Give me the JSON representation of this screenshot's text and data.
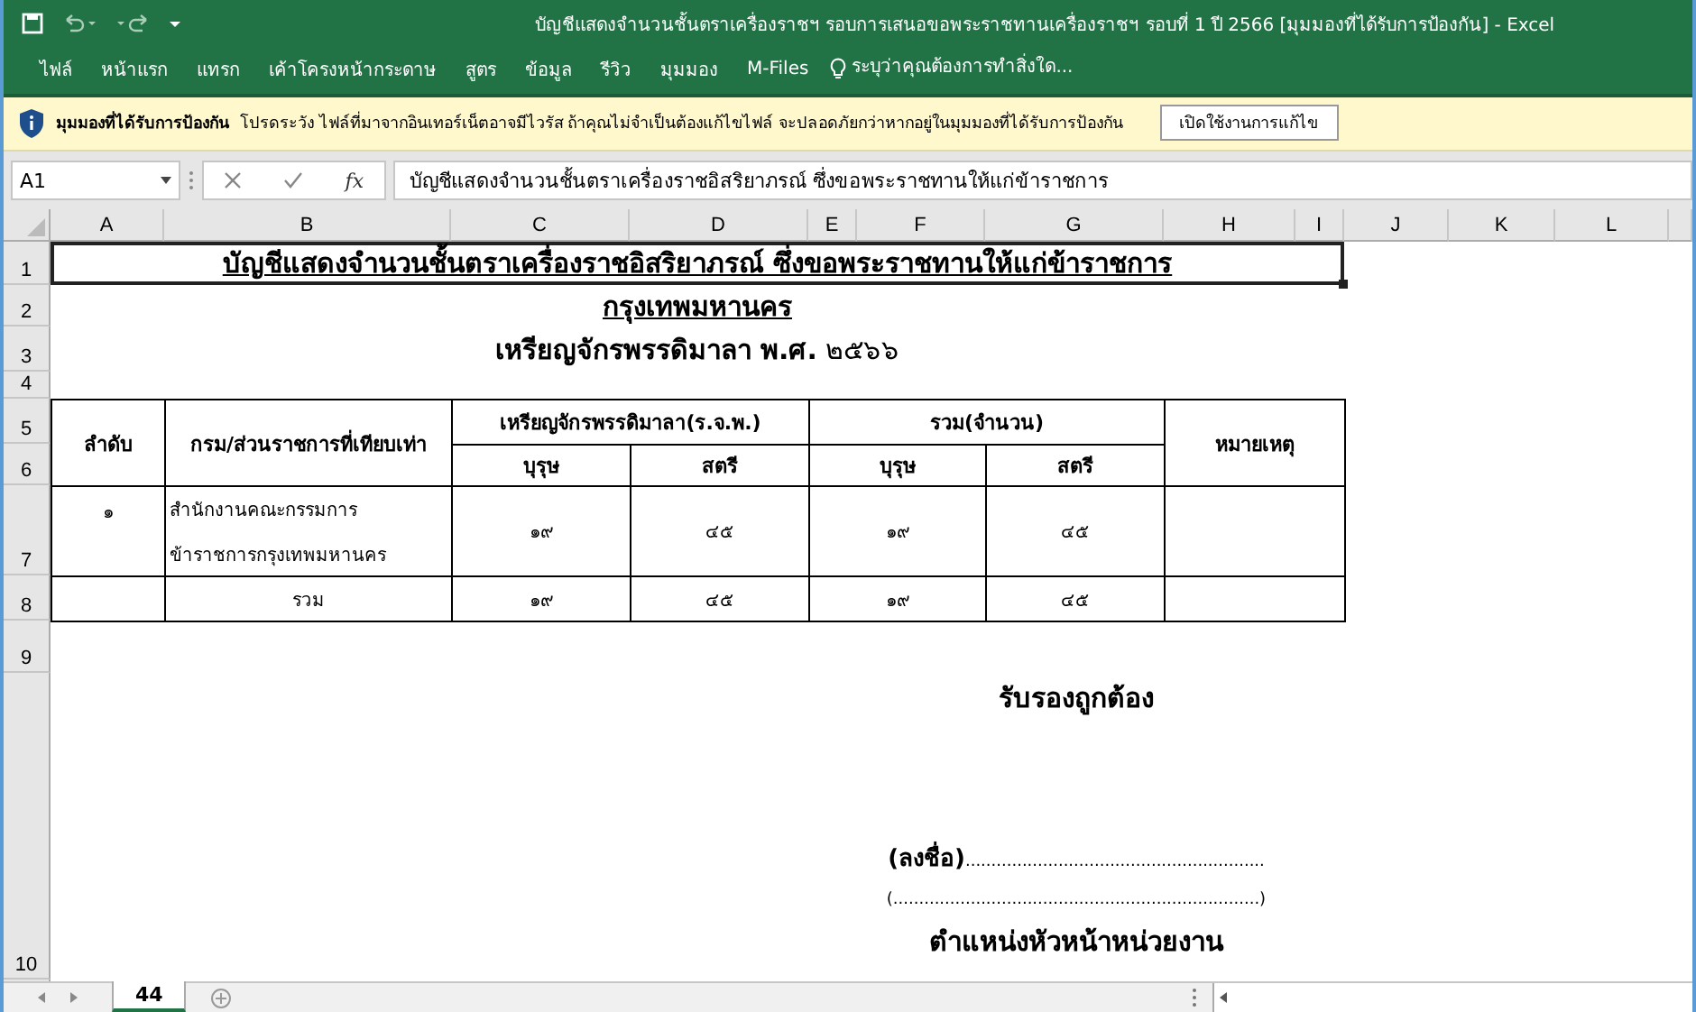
{
  "window": {
    "title": "บัญชีแสดงจำนวนชั้นตราเครื่องราชฯ รอบการเสนอขอพระราชทานเครื่องราชฯ รอบที่ 1 ปี 2566  [มุมมองที่ได้รับการป้องกัน] - Excel"
  },
  "ribbon_tabs": [
    "ไฟล์",
    "หน้าแรก",
    "แทรก",
    "เค้าโครงหน้ากระดาษ",
    "สูตร",
    "ข้อมูล",
    "รีวิว",
    "มุมมอง",
    "M-Files"
  ],
  "tell_me": {
    "placeholder": "ระบุว่าคุณต้องการทำสิ่งใด..."
  },
  "protected_view": {
    "title": "มุมมองที่ได้รับการป้องกัน",
    "message": "โปรดระวัง ไฟล์ที่มาจากอินเทอร์เน็ตอาจมีไวรัส ถ้าคุณไม่จำเป็นต้องแก้ไขไฟล์ จะปลอดภัยกว่าหากอยู่ในมุมมองที่ได้รับการป้องกัน",
    "button": "เปิดใช้งานการแก้ไข"
  },
  "formula_bar": {
    "name_box": "A1",
    "fx": "fx",
    "value": "บัญชีแสดงจำนวนชั้นตราเครื่องราชอิสริยาภรณ์ ซึ่งขอพระราชทานให้แก่ข้าราชการ"
  },
  "column_headers": [
    "A",
    "B",
    "C",
    "D",
    "E",
    "F",
    "G",
    "H",
    "I",
    "J",
    "K",
    "L"
  ],
  "row_headers": [
    "1",
    "2",
    "3",
    "4",
    "5",
    "6",
    "7",
    "8",
    "9",
    "10"
  ],
  "sheet": {
    "title": "บัญชีแสดงจำนวนชั้นตราเครื่องราชอิสริยาภรณ์ ซึ่งขอพระราชทานให้แก่ข้าราชการ",
    "subtitle": "กรุงเทพมหานคร",
    "medal_line": "**เหรียญจักรพรรดิมาลา พ.ศ.** ๒๕๖๖",
    "table": {
      "columns": [
        {
          "label": "ลำดับ"
        },
        {
          "label": "กรม/ส่วนราชการที่เทียบเท่า"
        },
        {
          "label": "เหรียญจักรพรรดิมาลา(ร.จ.พ.)",
          "children": [
            "บุรุษ",
            "สตรี"
          ]
        },
        {
          "label": "รวม(จำนวน)",
          "children": [
            "บุรุษ",
            "สตรี"
          ]
        },
        {
          "label": "หมายเหตุ"
        }
      ],
      "rows": [
        {
          "kind": "item",
          "number": "๑",
          "unit_lines": [
            "สำนักงานคณะกรรมการ",
            "ข้าราชการกรุงเทพมหานคร"
          ],
          "values": [
            "๑๙",
            "๔๕",
            "๑๙",
            "๔๕"
          ]
        },
        {
          "kind": "total",
          "label": "รวม",
          "values": [
            "๑๙",
            "๔๕",
            "๑๙",
            "๔๕"
          ]
        }
      ]
    },
    "signature": {
      "heading": "รับรองถูกต้อง",
      "sign_prefix": "(ลงชื่อ)",
      "sign_line": "..........................................................",
      "name_line": "(.......................................................................)",
      "position": "ตำแหน่งหัวหน้าหน่วยงาน"
    }
  },
  "sheet_tabs": [
    {
      "label": "44",
      "selected": true
    }
  ]
}
